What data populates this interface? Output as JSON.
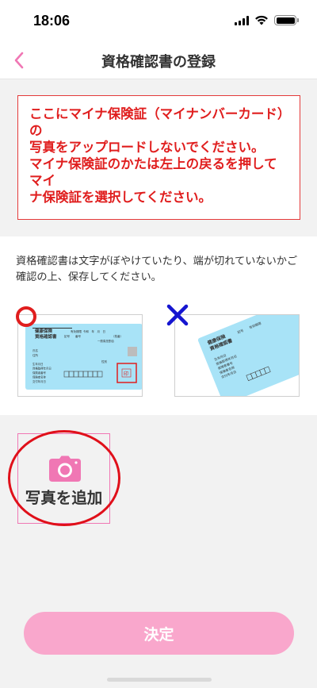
{
  "status_bar": {
    "time": "18:06"
  },
  "nav": {
    "title": "資格確認書の登録"
  },
  "warning": {
    "text": "ここにマイナ保険証（マイナンバーカード）の\n写真をアップロードしないでください。\nマイナ保険証のかたは左上の戻るを押してマイ\nナ保険証を選択してください。"
  },
  "info": {
    "text": "資格確認書は文字がぼやけていたり、端が切れていないかご確認の上、保存してください。"
  },
  "sample_card": {
    "title_line1": "健康保険",
    "title_line2": "資格確認書",
    "header_col1": "記号",
    "header_col2": "番号",
    "header_col3": "有効期限",
    "header_col4": "一般負担割合",
    "date_label": "令和　年　月　日",
    "branch_label": "（枝番）",
    "name_label": "氏名",
    "kana_label": "住所",
    "sex_label": "性別",
    "fields": [
      "生年月日",
      "資格取得年月日",
      "保険者番号",
      "保険者名称",
      "交付年月日"
    ],
    "stamp": "印"
  },
  "add_photo": {
    "label": "写真を追加"
  },
  "submit": {
    "label": "決定"
  },
  "colors": {
    "accent_pink": "#f077b4",
    "button_pink": "#f9a7cc",
    "warning_red": "#e01e1e",
    "card_blue": "#a8e3f7"
  }
}
